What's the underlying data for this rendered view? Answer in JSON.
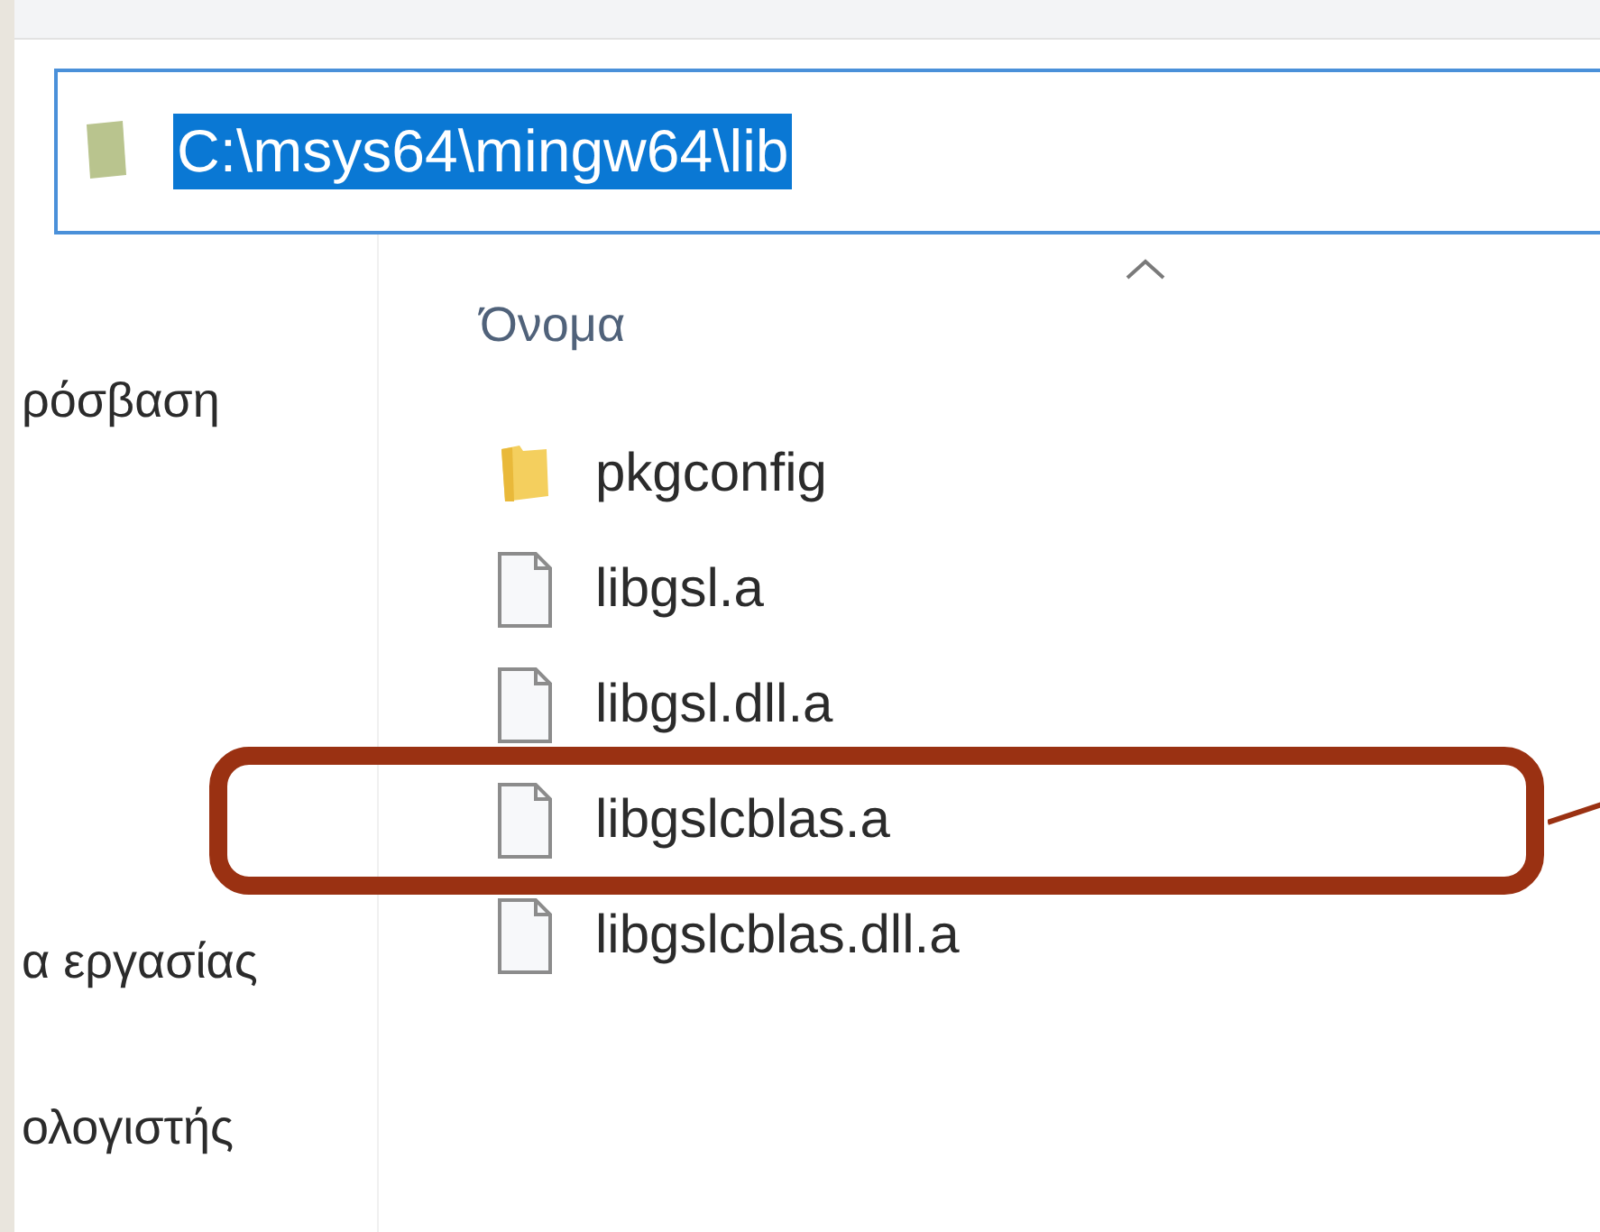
{
  "address_bar": {
    "path": "C:\\msys64\\mingw64\\lib",
    "selected": true
  },
  "sidebar": {
    "items": [
      {
        "label": "ρόσβαση"
      },
      {
        "label": "α εργασίας"
      },
      {
        "label": "ολογιστής"
      }
    ]
  },
  "file_list": {
    "columns": [
      {
        "label": "Όνομα"
      }
    ],
    "rows": [
      {
        "name": "pkgconfig",
        "kind": "folder",
        "highlighted": false
      },
      {
        "name": "libgsl.a",
        "kind": "file",
        "highlighted": false
      },
      {
        "name": "libgsl.dll.a",
        "kind": "file",
        "highlighted": false
      },
      {
        "name": "libgslcblas.a",
        "kind": "file",
        "highlighted": true
      },
      {
        "name": "libgslcblas.dll.a",
        "kind": "file",
        "highlighted": false
      }
    ]
  }
}
